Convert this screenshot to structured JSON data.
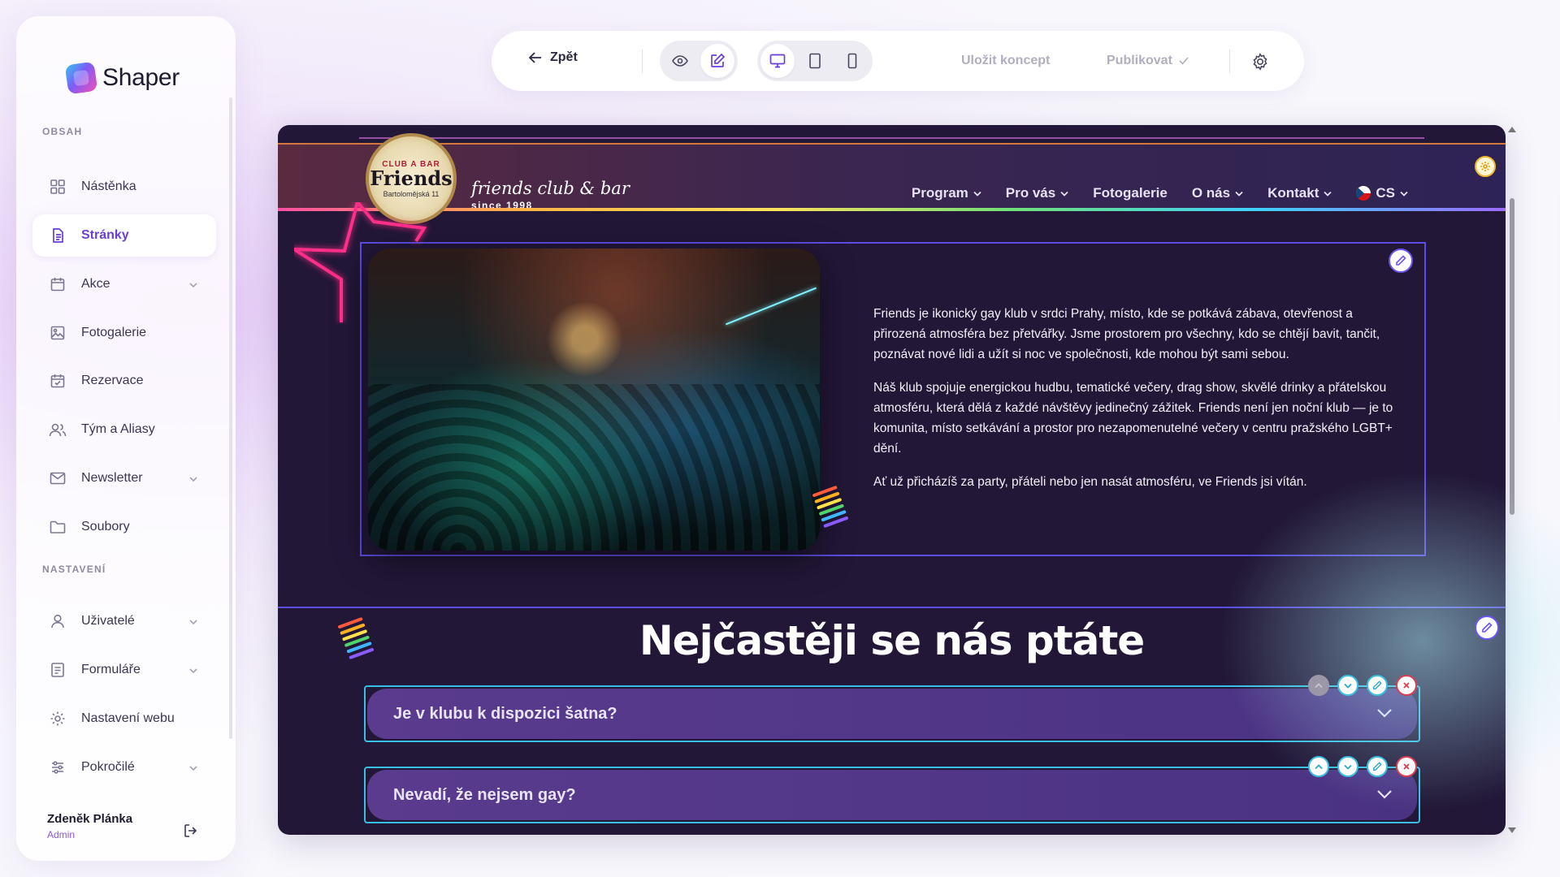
{
  "brand": {
    "name": "Shaper"
  },
  "sidebar": {
    "section_content": "OBSAH",
    "section_settings": "NASTAVENÍ",
    "items": [
      {
        "label": "Nástěnka",
        "icon": "dashboard-icon"
      },
      {
        "label": "Stránky",
        "icon": "page-icon",
        "active": true
      },
      {
        "label": "Akce",
        "icon": "calendar-icon"
      },
      {
        "label": "Fotogalerie",
        "icon": "image-icon"
      },
      {
        "label": "Rezervace",
        "icon": "calendar-check-icon"
      },
      {
        "label": "Tým a Aliasy",
        "icon": "users-icon"
      },
      {
        "label": "Newsletter",
        "icon": "mail-icon"
      },
      {
        "label": "Soubory",
        "icon": "folder-icon"
      }
    ],
    "settings_items": [
      {
        "label": "Uživatelé",
        "icon": "user-icon"
      },
      {
        "label": "Formuláře",
        "icon": "form-icon"
      },
      {
        "label": "Nastavení webu",
        "icon": "gear-icon"
      },
      {
        "label": "Pokročilé",
        "icon": "sliders-icon"
      }
    ],
    "user": {
      "name": "Zdeněk Plánka",
      "role": "Admin"
    }
  },
  "toolbar": {
    "back_label": "Zpět",
    "save_draft_label": "Uložit koncept",
    "publish_label": "Publikovat"
  },
  "site": {
    "badge_top": "CLUB A BAR",
    "badge_main": "Friends",
    "badge_sub": "Bartolomějská 11",
    "tagline": "friends club & bar",
    "since": "since 1998",
    "nav": {
      "program": "Program",
      "pro_vas": "Pro vás",
      "fotogalerie": "Fotogalerie",
      "o_nas": "O nás",
      "kontakt": "Kontakt",
      "lang": "CS"
    },
    "paragraphs": [
      "Friends je ikonický gay klub v srdci Prahy, místo, kde se potkává zábava, otevřenost a přirozená atmosféra bez přetvářky. Jsme prostorem pro všechny, kdo se chtějí bavit, tančit, poznávat nové lidi a užít si noc ve společnosti, kde mohou být sami sebou.",
      "Náš klub spojuje energickou hudbu, tematické večery, drag show, skvělé drinky a přátelskou atmosféru, která dělá z každé návštěvy jedinečný zážitek. Friends není jen noční klub — je to komunita, místo setkávání a prostor pro nezapomenutelné večery v centru pražského LGBT+ dění.",
      "Ať už přicházíš za party, přáteli nebo jen nasát atmosféru, ve Friends jsi vítán."
    ],
    "faq_title": "Nejčastěji se nás ptáte",
    "faq": [
      {
        "question": "Je v klubu k dispozici šatna?"
      },
      {
        "question": "Nevadí, že nejsem gay?"
      }
    ]
  },
  "colors": {
    "accent": "#6a3fd8",
    "canvas_bg": "#221737",
    "selection": "#5b4de0",
    "faq_border": "#38bfe4"
  }
}
